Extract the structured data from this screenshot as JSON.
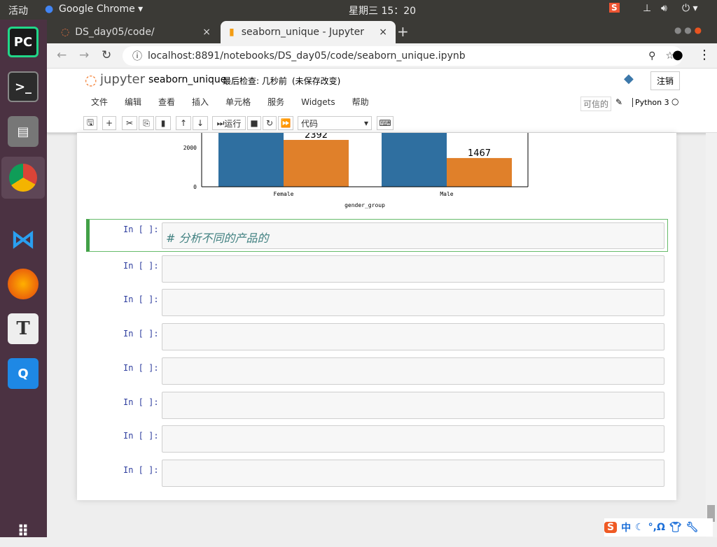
{
  "system": {
    "activities": "活动",
    "app": "Google Chrome ▾",
    "clock": "星期三 15：20"
  },
  "browser": {
    "tabs": [
      {
        "label": "DS_day05/code/"
      },
      {
        "label": "seaborn_unique - Jupyter"
      }
    ],
    "url": "localhost:8891/notebooks/DS_day05/code/seaborn_unique.ipynb"
  },
  "jupyter": {
    "logo": "jupyter",
    "notebook_name": "seaborn_unique",
    "checkpoint": "最后检查: 几秒前",
    "unsaved": "(未保存改变)",
    "logout": "注销",
    "menu": [
      "文件",
      "编辑",
      "查看",
      "插入",
      "单元格",
      "服务",
      "Widgets",
      "帮助"
    ],
    "trusted": "可信的",
    "kernel": "Python 3",
    "run_label": "运行",
    "cell_type": "代码"
  },
  "chart_data": {
    "type": "bar",
    "categories": [
      "Female",
      "Male"
    ],
    "xlabel": "gender_group",
    "ylabel": "",
    "yticks": [
      "0",
      "2000"
    ],
    "series": [
      {
        "values": [
          null,
          null
        ],
        "color": "#2f6fa0"
      },
      {
        "values": [
          2392,
          1467
        ],
        "color": "#e0802a"
      }
    ],
    "data_labels": [
      "2392",
      "1467"
    ]
  },
  "cells": [
    {
      "prompt": "In [ ]:",
      "source": "# 分析不同的产品的"
    },
    {
      "prompt": "In [ ]:",
      "source": ""
    },
    {
      "prompt": "In [ ]:",
      "source": ""
    },
    {
      "prompt": "In [ ]:",
      "source": ""
    },
    {
      "prompt": "In [ ]:",
      "source": ""
    },
    {
      "prompt": "In [ ]:",
      "source": ""
    },
    {
      "prompt": "In [ ]:",
      "source": ""
    },
    {
      "prompt": "In [ ]:",
      "source": ""
    }
  ],
  "ime": {
    "lang": "中",
    "symbols": "°,Ω"
  }
}
